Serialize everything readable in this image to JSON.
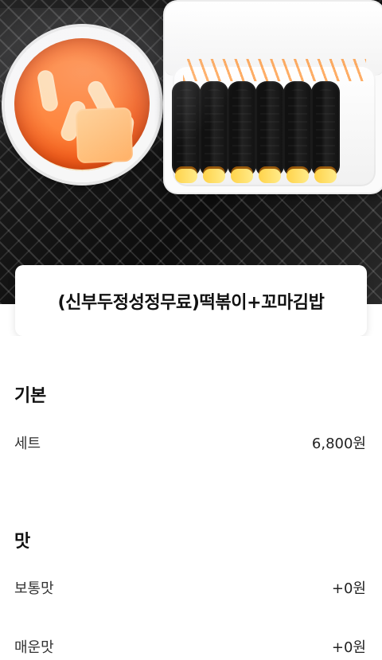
{
  "hero": {
    "photo_description": ""
  },
  "title_card": {
    "title": "(신부두정성정무료)떡볶이+꼬마김밥"
  },
  "sections": [
    {
      "title": "기본",
      "rows": [
        {
          "label": "세트",
          "price": "6,800원"
        }
      ]
    },
    {
      "title": "맛",
      "rows": [
        {
          "label": "보통맛",
          "price": "+0원"
        },
        {
          "label": "매운맛",
          "price": "+0원"
        }
      ]
    }
  ]
}
